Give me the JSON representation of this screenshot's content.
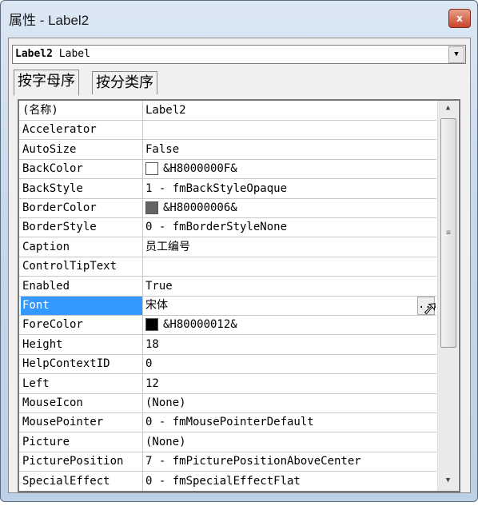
{
  "window": {
    "title": "属性 - Label2",
    "close": "x"
  },
  "object_selector": {
    "name": "Label2",
    "type": "Label"
  },
  "tabs": [
    {
      "label": "按字母序",
      "active": true
    },
    {
      "label": "按分类序",
      "active": false
    }
  ],
  "properties": [
    {
      "name": "(名称)",
      "value": "Label2"
    },
    {
      "name": "Accelerator",
      "value": ""
    },
    {
      "name": "AutoSize",
      "value": "False"
    },
    {
      "name": "BackColor",
      "value": "&H8000000F&",
      "swatch": "#ffffff"
    },
    {
      "name": "BackStyle",
      "value": "1 - fmBackStyleOpaque"
    },
    {
      "name": "BorderColor",
      "value": "&H80000006&",
      "swatch": "#646464"
    },
    {
      "name": "BorderStyle",
      "value": "0 - fmBorderStyleNone"
    },
    {
      "name": "Caption",
      "value": "员工编号"
    },
    {
      "name": "ControlTipText",
      "value": ""
    },
    {
      "name": "Enabled",
      "value": "True"
    },
    {
      "name": "Font",
      "value": "宋体",
      "selected": true,
      "button": "..."
    },
    {
      "name": "ForeColor",
      "value": "&H80000012&",
      "swatch": "#000000"
    },
    {
      "name": "Height",
      "value": "18"
    },
    {
      "name": "HelpContextID",
      "value": "0"
    },
    {
      "name": "Left",
      "value": "12"
    },
    {
      "name": "MouseIcon",
      "value": "(None)"
    },
    {
      "name": "MousePointer",
      "value": "0 - fmMousePointerDefault"
    },
    {
      "name": "Picture",
      "value": "(None)"
    },
    {
      "name": "PicturePosition",
      "value": "7 - fmPicturePositionAboveCenter"
    },
    {
      "name": "SpecialEffect",
      "value": "0 - fmSpecialEffectFlat"
    }
  ],
  "colors": {
    "selection": "#3399ff",
    "close": "#c8452c"
  }
}
